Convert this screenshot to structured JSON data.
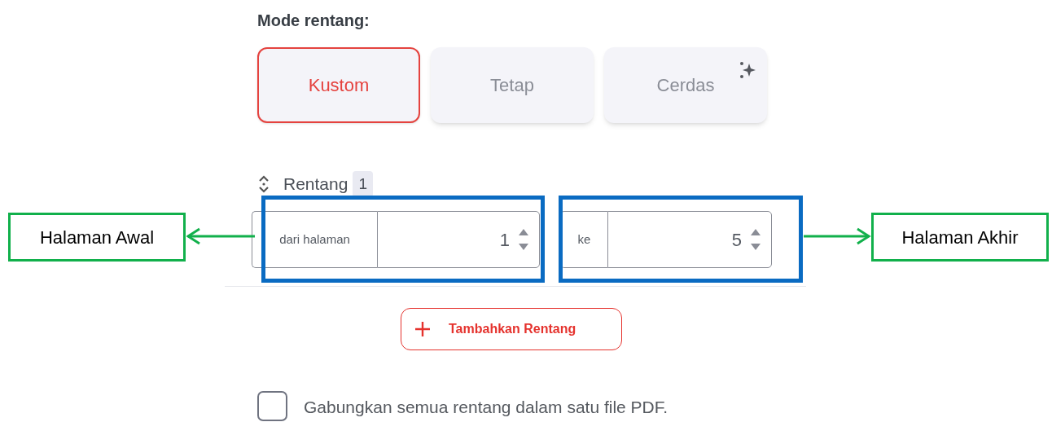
{
  "heading": "Mode rentang:",
  "modes": [
    {
      "label": "Kustom",
      "selected": true,
      "kind": "plain"
    },
    {
      "label": "Tetap",
      "selected": false,
      "kind": "plain"
    },
    {
      "label": "Cerdas",
      "selected": false,
      "kind": "smart"
    }
  ],
  "range": {
    "title": "Rentang",
    "count": "1",
    "fields": [
      {
        "label": "dari halaman",
        "value": "1"
      },
      {
        "label": "ke",
        "value": "5"
      }
    ]
  },
  "add_button": "Tambahkan Rentang",
  "merge_option": {
    "label": "Gabungkan semua rentang dalam satu file PDF.",
    "checked": false
  },
  "annotations": [
    {
      "text": "Halaman Awal",
      "kind": "left"
    },
    {
      "text": "Halaman Akhir",
      "kind": "right"
    }
  ]
}
